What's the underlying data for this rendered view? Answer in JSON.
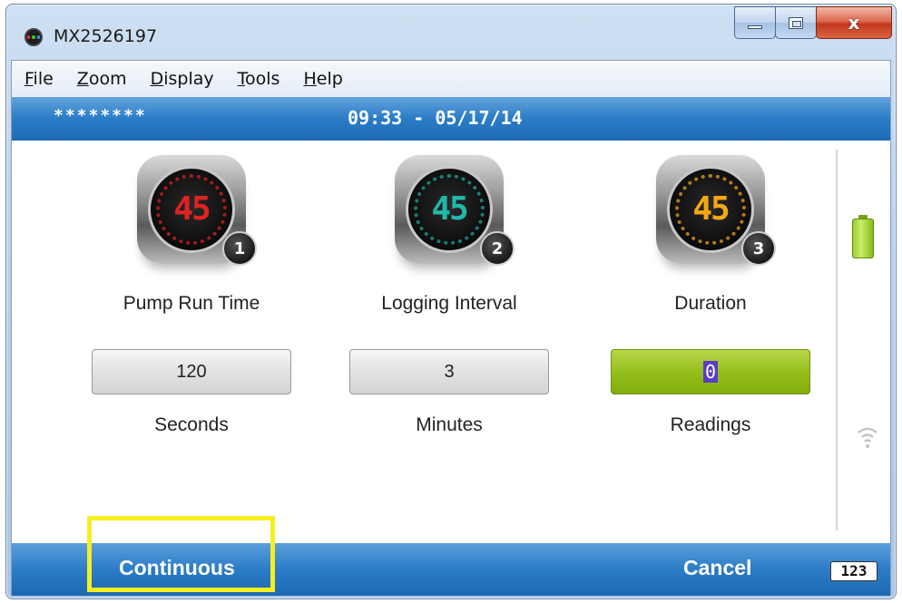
{
  "window": {
    "title": "MX2526197",
    "close_label": "x"
  },
  "menu": {
    "items": [
      {
        "accel": "F",
        "rest": "ile"
      },
      {
        "accel": "Z",
        "rest": "oom"
      },
      {
        "accel": "D",
        "rest": "isplay"
      },
      {
        "accel": "T",
        "rest": "ools"
      },
      {
        "accel": "H",
        "rest": "elp"
      }
    ]
  },
  "status": {
    "password_mask": "********",
    "datetime": "09:33 - 05/17/14"
  },
  "settings": [
    {
      "dial_value": "45",
      "badge": "1",
      "label": "Pump Run Time",
      "value": "120",
      "unit": "Seconds",
      "color": "#d42020"
    },
    {
      "dial_value": "45",
      "badge": "2",
      "label": "Logging Interval",
      "value": "3",
      "unit": "Minutes",
      "color": "#1aa59a"
    },
    {
      "dial_value": "45",
      "badge": "3",
      "label": "Duration",
      "value": "0",
      "unit": "Readings",
      "color": "#f0a010"
    }
  ],
  "footer": {
    "continuous_label": "Continuous",
    "cancel_label": "Cancel",
    "keypad_label": "123"
  },
  "icons": {
    "battery": "battery-icon",
    "signal": "wireless-signal-icon",
    "check": "checkmark-icon"
  },
  "colors": {
    "accent_blue": "#2a7cc7",
    "active_green": "#96bf1c",
    "highlight_yellow": "#f5ee22"
  }
}
